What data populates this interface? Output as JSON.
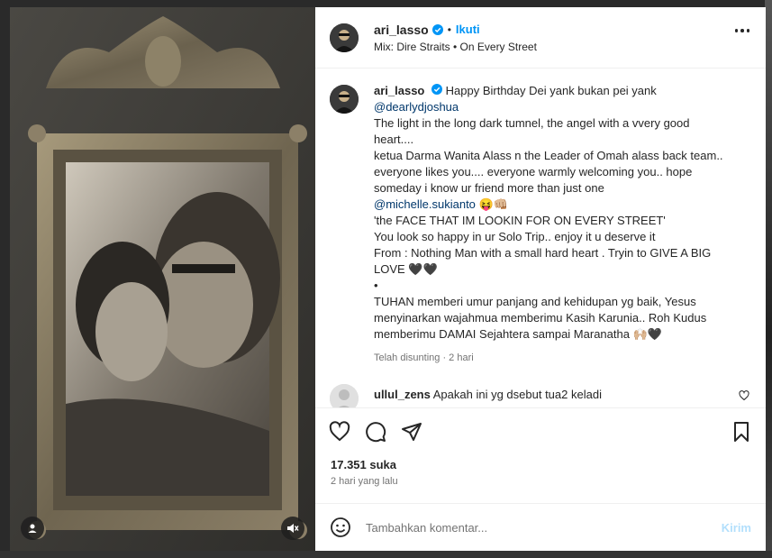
{
  "post": {
    "username": "ari_lasso",
    "follow_label": "Ikuti",
    "separator": "•",
    "audio": "Mix: Dire Straits • On Every Street"
  },
  "caption": {
    "username": "ari_lasso",
    "lines": [
      "Happy Birthday Dei yank bukan pei yank",
      "@dearlydjoshua",
      "The light in the long dark tumnel, the angel with a vvery good heart....",
      "ketua Darma Wanita Alass n the Leader of Omah alass back team.. everyone likes you.... everyone warmly welcoming you.. hope someday i know ur friend more than just one",
      "@michelle.sukianto 😝👊🏼",
      "'the FACE THAT IM LOOKIN FOR ON EVERY STREET'",
      "You look so happy in ur Solo Trip.. enjoy it u deserve it",
      "From : Nothing Man with a small hard heart . Tryin to GIVE A BIG LOVE 🖤🖤",
      "•",
      "TUHAN memberi umur panjang and kehidupan yg baik, Yesus menyinarkan wajahmua memberimu Kasih Karunia.. Roh Kudus memberimu DAMAI Sejahtera sampai Maranatha 🙌🏼🖤"
    ],
    "first_line": "Happy Birthday Dei yank bukan pei yank",
    "mention1": "@dearlydjoshua",
    "line3": "The light in the long dark tumnel, the angel with a vvery good heart....",
    "line4": "ketua Darma Wanita Alass n the Leader of Omah alass back team.. everyone likes you.... everyone warmly welcoming you.. hope someday i know ur friend more than just one",
    "mention2": "@michelle.sukianto",
    "mention2_emoji": " 😝👊🏼",
    "line6": "'the FACE THAT IM LOOKIN FOR ON EVERY STREET'",
    "line7": "You look so happy in ur Solo Trip.. enjoy it u deserve it",
    "line8": "From : Nothing Man with a small hard heart . Tryin to GIVE A BIG LOVE 🖤🖤",
    "line9": "•",
    "line10": "TUHAN memberi umur panjang and kehidupan yg baik, Yesus menyinarkan wajahmua memberimu Kasih Karunia.. Roh Kudus memberimu DAMAI Sejahtera sampai Maranatha 🙌🏼🖤",
    "meta": "Telah disunting · 2 hari"
  },
  "reply": {
    "username": "ullul_zens",
    "text": "Apakah ini yg dsebut tua2 keladi"
  },
  "stats": {
    "likes": "17.351 suka",
    "time_ago": "2 hari yang lalu"
  },
  "composer": {
    "placeholder": "Tambahkan komentar...",
    "post_label": "Kirim"
  },
  "icons": {
    "like": "heart-icon",
    "comment": "comment-icon",
    "share": "send-icon",
    "save": "bookmark-icon",
    "more": "more-options-icon",
    "emoji": "emoji-icon",
    "verified": "verified-badge-icon",
    "user_tag": "user-tag-icon",
    "mute": "muted-speaker-icon"
  },
  "colors": {
    "link": "#0095f6",
    "mention": "#00376b",
    "muted": "#737373",
    "post_disabled": "#b2dffc"
  }
}
